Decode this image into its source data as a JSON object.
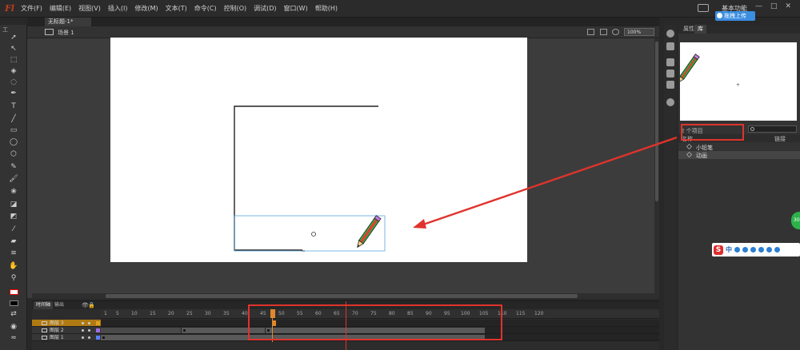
{
  "app": {
    "logo": "Fl",
    "menu": [
      "文件(F)",
      "编辑(E)",
      "视图(V)",
      "插入(I)",
      "修改(M)",
      "文本(T)",
      "命令(C)",
      "控制(O)",
      "调试(D)",
      "窗口(W)",
      "帮助(H)"
    ],
    "workspace": "基本功能",
    "upload_badge": "拖拽上传",
    "window_controls": [
      "—",
      "□",
      "✕"
    ]
  },
  "document": {
    "tab_title": "无标题-1*",
    "scene_label": "场景 1",
    "zoom": "100%"
  },
  "toolbar": {
    "header": "工",
    "tools": [
      "selection-tool",
      "subselection-tool",
      "free-transform-tool",
      "3d-rotation-tool",
      "lasso-tool",
      "pen-tool",
      "text-tool",
      "line-tool",
      "rectangle-tool",
      "oval-tool",
      "polystar-tool",
      "pencil-tool",
      "brush-tool",
      "deco-tool",
      "bone-tool",
      "paint-bucket-tool",
      "eyedropper-tool",
      "eraser-tool",
      "width-tool",
      "hand-tool",
      "zoom-tool",
      "stroke-color",
      "fill-color",
      "snap-tool"
    ]
  },
  "panel": {
    "tabs": [
      "属性",
      "库"
    ],
    "item_count": "2 个项目",
    "columns": {
      "name": "名称",
      "linkage": "链接"
    },
    "items": [
      "小铅笔",
      "动画"
    ]
  },
  "timeline": {
    "tabs": [
      "时间轴",
      "输出"
    ],
    "frame_numbers": [
      "1",
      "5",
      "10",
      "15",
      "20",
      "25",
      "30",
      "35",
      "40",
      "45",
      "50",
      "55",
      "60",
      "65",
      "70",
      "75",
      "80",
      "85",
      "90",
      "95",
      "100",
      "105",
      "110",
      "115",
      "120"
    ],
    "layers": [
      {
        "name": "图层 3",
        "selected": true,
        "color": "#e0a020"
      },
      {
        "name": "图层 2",
        "selected": false,
        "color": "#9f6fe0"
      },
      {
        "name": "图层 1",
        "selected": false,
        "color": "#5a7fff"
      }
    ]
  },
  "ime": {
    "logo": "S",
    "lang": "中"
  },
  "side_badge": "30"
}
